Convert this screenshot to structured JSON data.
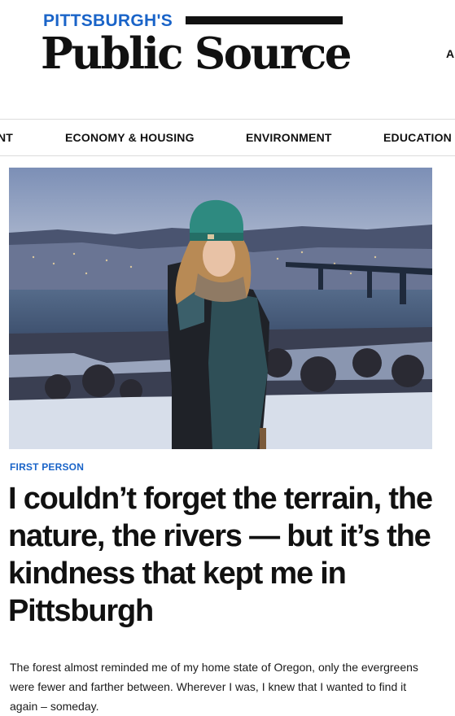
{
  "header": {
    "logo_top": "PITTSBURGH'S",
    "logo_main": "Public Source",
    "edge_text": "A"
  },
  "nav": {
    "items": [
      {
        "label": "NT"
      },
      {
        "label": "ECONOMY & HOUSING"
      },
      {
        "label": "ENVIRONMENT"
      },
      {
        "label": "EDUCATION"
      }
    ]
  },
  "article": {
    "kicker": "FIRST PERSON",
    "headline": "I couldn’t forget the terrain, the nature, the rivers — but it’s the kindness that kept me in Pittsburgh",
    "dek": "The forest almost reminded me of my home state of Oregon, only the evergreens were fewer and farther between. Wherever I was, I knew that I wanted to find it again – someday."
  },
  "colors": {
    "brand_blue": "#1a64c8",
    "text": "#111111"
  }
}
